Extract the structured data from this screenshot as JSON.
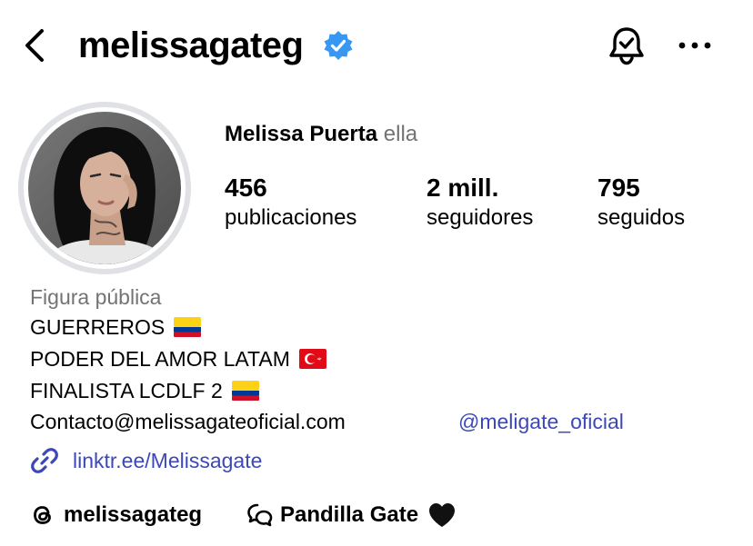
{
  "header": {
    "username": "melissagateg",
    "back_icon": "chevron-left-icon",
    "verified_icon": "verified-badge-icon",
    "verified_color": "#3897f0",
    "bell_icon": "bell-check-icon",
    "more_icon": "more-horizontal-icon"
  },
  "profile": {
    "full_name": "Melissa Puerta",
    "pronouns": "ella",
    "avatar_icon": "profile-photo"
  },
  "stats": {
    "posts_count": "456",
    "posts_label": "publicaciones",
    "followers_count": "2 mill.",
    "followers_label": "seguidores",
    "following_count": "795",
    "following_label": "seguidos"
  },
  "bio": {
    "category": "Figura pública",
    "line1": "GUERREROS",
    "line1_flag": "colombia-flag-icon",
    "line2": "PODER DEL AMOR LATAM",
    "line2_flag": "turkey-flag-icon",
    "line3": "FINALISTA LCDLF 2",
    "line3_flag": "colombia-flag-icon",
    "contact": "Contacto@melissagateoficial.com",
    "mention": "@meligate_oficial"
  },
  "link": {
    "icon": "link-icon",
    "text": "linktr.ee/Melissagate"
  },
  "footer": {
    "threads_icon": "threads-icon",
    "threads_handle": "melissagateg",
    "channel_icon": "broadcast-channel-icon",
    "channel_name": "Pandilla Gate",
    "heart_icon": "black-heart-icon"
  },
  "colors": {
    "link_blue": "#3d48b8",
    "secondary_text": "#737373"
  }
}
